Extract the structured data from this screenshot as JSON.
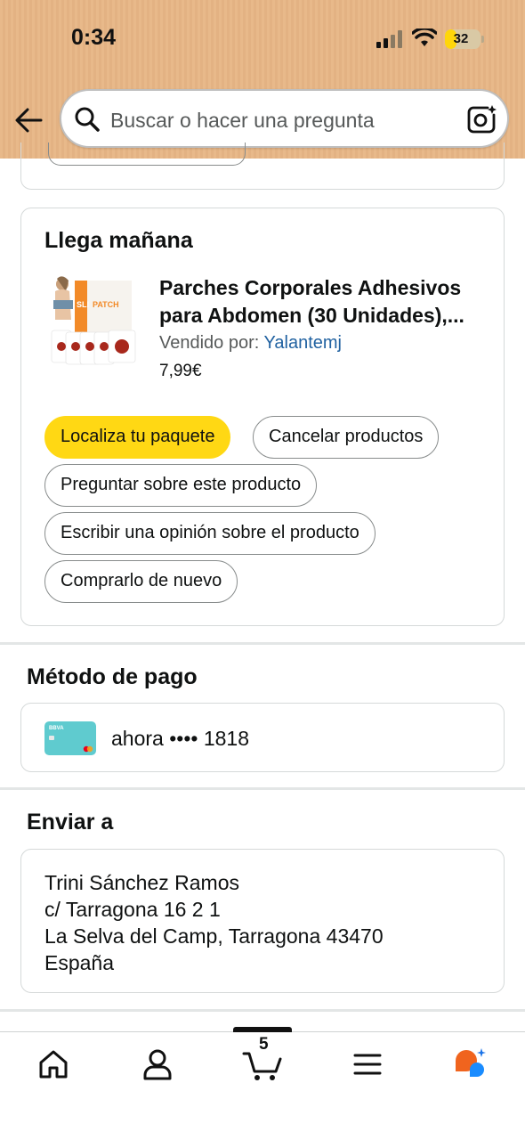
{
  "status_bar": {
    "time": "0:34",
    "battery": "32",
    "battery_level": 0.32
  },
  "search": {
    "placeholder": "Buscar o hacer una pregunta"
  },
  "delivery": {
    "title": "Llega mañana",
    "product_title_line1": "Parches Corporales Adhesivos",
    "product_title_line2": "para Abdomen (30 Unidades),...",
    "seller_prefix": "Vendido por:",
    "seller_name": "Yalantemj",
    "price": "7,99€",
    "image_brand_text": "SLIM PATCH",
    "buttons": {
      "track": "Localiza tu paquete",
      "cancel": "Cancelar productos",
      "ask": "Preguntar sobre este producto",
      "review": "Escribir una opinión sobre el producto",
      "buy_again": "Comprarlo de nuevo"
    }
  },
  "payment": {
    "title": "Método de pago",
    "method": "ahora •••• 1818",
    "card_brand": "BBVA"
  },
  "shipping": {
    "title": "Enviar a",
    "name": "Trini Sánchez Ramos",
    "street": "c/ Tarragona 16 2 1",
    "city": "La Selva del Camp, Tarragona 43470",
    "country": "España"
  },
  "tabbar": {
    "cart_count": "5"
  },
  "colors": {
    "primary_button": "#ffd814",
    "link": "#2162a1",
    "header": "#e8b98a"
  },
  "icons": [
    "back-arrow-icon",
    "search-icon",
    "camera-icon",
    "home-icon",
    "account-icon",
    "cart-icon",
    "menu-icon",
    "rufus-icon"
  ]
}
